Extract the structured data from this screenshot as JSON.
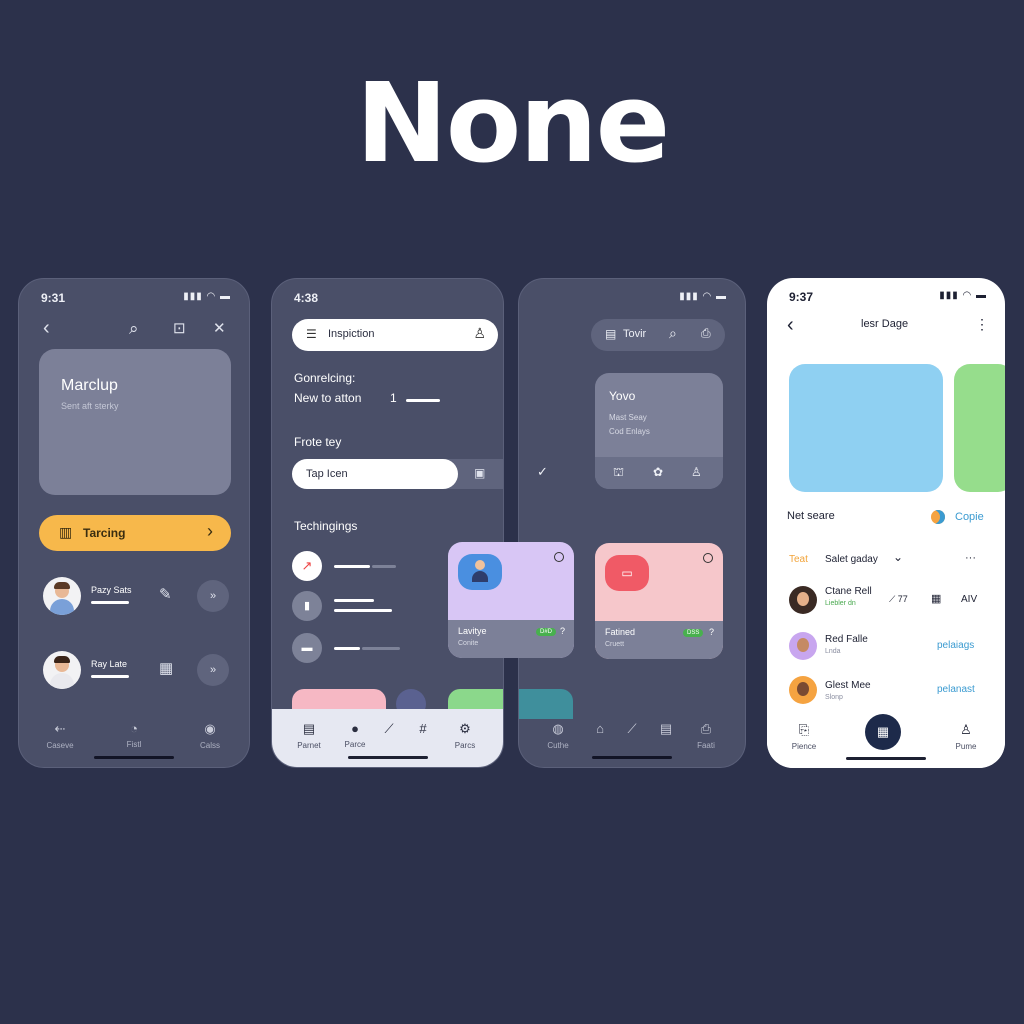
{
  "hero": {
    "title": "None"
  },
  "phone1": {
    "time": "9:31",
    "status_icons": "▮▮▮ ◠ ▬",
    "nav": {
      "back": "‹",
      "search": "⌕",
      "bookmark": "⊡",
      "close": "✕"
    },
    "card": {
      "title": "Marclup",
      "subtitle": "Sent aft sterky"
    },
    "cta": {
      "label": "Tarcing",
      "icon": "▥",
      "arrow": "›"
    },
    "contacts": [
      {
        "name": "Pazy Sats",
        "action_icon": "✎",
        "go": "»"
      },
      {
        "name": "Ray Late",
        "action_icon": "▦",
        "go": "»"
      }
    ],
    "tabs": [
      {
        "icon": "⇠",
        "label": "Caseve"
      },
      {
        "icon": "◔",
        "label": "Fistl"
      },
      {
        "icon": "◉",
        "label": "Calss"
      }
    ]
  },
  "phone2": {
    "time": "4:38",
    "search": {
      "value": "Inspiction",
      "menu_icon": "☰",
      "profile_icon": "♙"
    },
    "section1": {
      "line1": "Gonrelcing:",
      "line2": "New to atton",
      "count": "1"
    },
    "section2": {
      "title": "Frote tey",
      "toggle_label": "Tap Icen",
      "toggle_icon": "▣",
      "check": "✓"
    },
    "section3": {
      "title": "Techingings"
    },
    "list_items": [
      {
        "icon": "↗",
        "color": "#ffffff"
      },
      {
        "icon": "▮",
        "color": "#7d8298"
      },
      {
        "icon": "▬",
        "color": "#7d8298"
      }
    ],
    "tabs": [
      {
        "icon": "▤",
        "label": "Parnet"
      },
      {
        "icon": "●",
        "label": "Parce"
      },
      {
        "icon": "⟋",
        "label": ""
      },
      {
        "icon": "#",
        "label": ""
      },
      {
        "icon": "⚙",
        "label": "Parcs"
      }
    ]
  },
  "phone3": {
    "search": {
      "value": "Tovir",
      "menu_icon": "▤",
      "search_icon": "⌕",
      "lock_icon": "⎙"
    },
    "card": {
      "title": "Yovo",
      "line1": "Mast Seay",
      "line2": "Cod Enlays",
      "icons": [
        "⛫",
        "✿",
        "♙"
      ]
    },
    "tiles": [
      {
        "title": "Lavitye",
        "subtitle": "Conite",
        "badge": "D#D",
        "more": "?"
      },
      {
        "title": "Fatined",
        "subtitle": "Cruett",
        "badge": "DSS",
        "more": "?"
      }
    ],
    "tabs": [
      {
        "icon": "◍",
        "label": "Cuthe"
      },
      {
        "icon": "⌂",
        "label": ""
      },
      {
        "icon": "⟋",
        "label": ""
      },
      {
        "icon": "▤",
        "label": ""
      },
      {
        "icon": "⎙",
        "label": "Faati"
      }
    ]
  },
  "phone4": {
    "time": "9:37",
    "nav": {
      "back": "‹",
      "title": "lesr Dage",
      "more": "⋮"
    },
    "section": {
      "title": "Net seare",
      "action": "Copie"
    },
    "filter": {
      "label": "Teat",
      "value": "Salet gaday",
      "chevron": "⌄",
      "more": "···"
    },
    "people": [
      {
        "name": "Ctane Rell",
        "sub": "Liebler dn",
        "icons": "⟋ 77",
        "grid": "▦",
        "tag": "AIV",
        "tag_color": "#1d2032"
      },
      {
        "name": "Red Falle",
        "sub": "Lnda",
        "icons": "",
        "grid": "",
        "tag": "pelaiags",
        "tag_color": "#3b9bd1"
      },
      {
        "name": "Glest Mee",
        "sub": "Slonp",
        "icons": "",
        "grid": "",
        "tag": "pelanast",
        "tag_color": "#3b9bd1"
      }
    ],
    "tabs": [
      {
        "icon": "⎘",
        "label": "Pience"
      },
      {
        "icon": "▦",
        "label": ""
      },
      {
        "icon": "♙",
        "label": "Pume"
      }
    ]
  },
  "colors": {
    "background": "#2c314b",
    "accent": "#f7b84b",
    "phone_dark": "#4a4f68",
    "link": "#3b9bd1"
  }
}
